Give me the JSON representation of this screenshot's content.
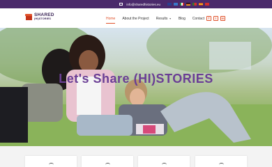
{
  "topbar": {
    "email": "info@sharedhistories.eu",
    "flags": [
      {
        "name": "uk-flag",
        "color": "#2a3f8f"
      },
      {
        "name": "estonia-flag",
        "color": "#3a78c8"
      },
      {
        "name": "italy-flag",
        "color": "#2d9c46"
      },
      {
        "name": "germany-flag",
        "color": "#d6a319"
      },
      {
        "name": "portugal-flag",
        "color": "#c8302d"
      },
      {
        "name": "spain-flag",
        "color": "#d84a28"
      },
      {
        "name": "turkey-flag",
        "color": "#d22f2f"
      }
    ]
  },
  "header": {
    "logo_line1": "SHARED",
    "logo_line2": "(HI)STORIES",
    "nav": [
      {
        "label": "Home",
        "active": true
      },
      {
        "label": "About the Project"
      },
      {
        "label": "Results",
        "dropdown": true
      },
      {
        "label": "Blog"
      },
      {
        "label": "Contact"
      }
    ],
    "social": [
      "f",
      "t",
      "in"
    ]
  },
  "hero": {
    "title": "Let's Share (HI)STORIES"
  },
  "colors": {
    "accent": "#e0522b",
    "brand_purple": "#6a3e95",
    "topbar": "#4b2a6b"
  }
}
